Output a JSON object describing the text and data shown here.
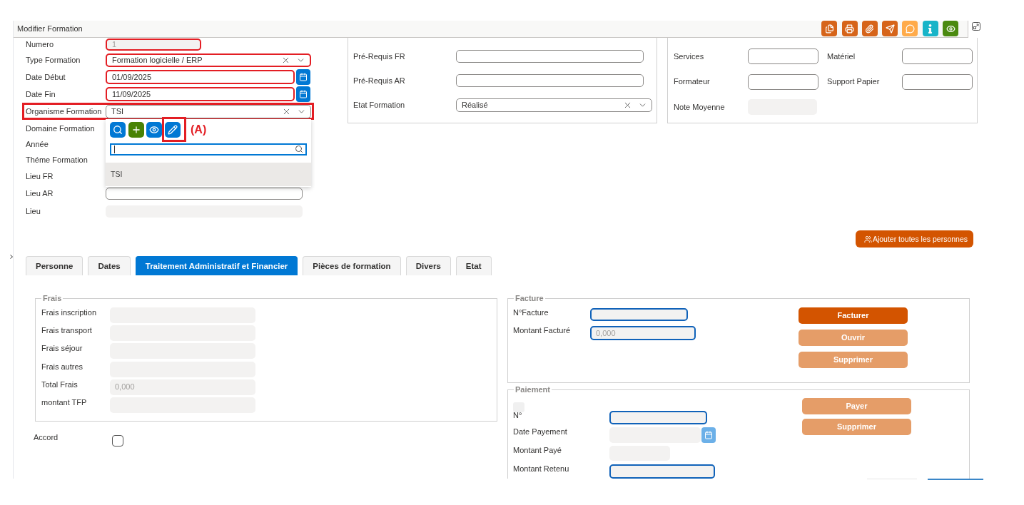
{
  "header": {
    "title": "Modifier Formation",
    "actions": [
      {
        "kind": "documents",
        "color": "#d6641a"
      },
      {
        "kind": "print",
        "color": "#d6641a"
      },
      {
        "kind": "attach",
        "color": "#d6641a"
      },
      {
        "kind": "send",
        "color": "#d6641a"
      },
      {
        "kind": "comment",
        "color": "#ffab4a"
      },
      {
        "kind": "info",
        "color": "#18b4c8"
      },
      {
        "kind": "view",
        "color": "#4b8a10"
      }
    ]
  },
  "identity": {
    "rows": [
      {
        "label": "Numero",
        "kind": "number",
        "value": "1",
        "highlighted": true
      },
      {
        "label": "Type Formation",
        "kind": "select",
        "value": "Formation logicielle / ERP",
        "highlighted": true
      },
      {
        "label": "Date Début",
        "kind": "date",
        "value": "01/09/2025",
        "highlighted": true
      },
      {
        "label": "Date Fin",
        "kind": "date",
        "value": "11/09/2025",
        "highlighted": true
      },
      {
        "label": "Organisme Formation",
        "kind": "select",
        "value": "TSI",
        "framed": true,
        "dropdown": {
          "actions": [
            {
              "kind": "search"
            },
            {
              "kind": "add"
            },
            {
              "kind": "view"
            },
            {
              "kind": "edit",
              "highlighted": true,
              "annotation": "(A)"
            }
          ],
          "options": [
            {
              "label": "TSI",
              "selected": true
            }
          ]
        }
      },
      {
        "label": "Domaine Formation"
      },
      {
        "label": "Année"
      },
      {
        "label": "Théme Formation"
      },
      {
        "label": "Lieu FR"
      },
      {
        "label": "Lieu AR",
        "kind": "text"
      },
      {
        "label": "Lieu",
        "kind": "disabled"
      }
    ]
  },
  "prerequisites": {
    "rows": [
      {
        "label": "Pré-Requis FR",
        "kind": "text"
      },
      {
        "label": "Pré-Requis AR",
        "kind": "text"
      },
      {
        "label": "Etat Formation",
        "kind": "select",
        "value": "Réalisé"
      }
    ]
  },
  "note": {
    "rows": [
      {
        "label": "Services",
        "kind": "text"
      },
      {
        "label": "Matériel",
        "kind": "text"
      },
      {
        "label": "Formateur",
        "kind": "text"
      },
      {
        "label": "Support Papier",
        "kind": "text"
      },
      {
        "label": "Note Moyenne",
        "kind": "disabled"
      }
    ]
  },
  "add_all_button": {
    "label": "Ajouter toutes les personnes"
  },
  "tabs": [
    {
      "label": "Personne",
      "selected": false
    },
    {
      "label": "Dates",
      "selected": false
    },
    {
      "label": "Traitement Administratif et Financier",
      "selected": true
    },
    {
      "label": "Pièces de formation",
      "selected": false
    },
    {
      "label": "Divers",
      "selected": false
    },
    {
      "label": "Etat",
      "selected": false
    }
  ],
  "frais": {
    "legend": "Frais",
    "rows": [
      {
        "label": "Frais inscription"
      },
      {
        "label": "Frais transport"
      },
      {
        "label": "Frais séjour"
      },
      {
        "label": "Frais autres"
      },
      {
        "label": "Total Frais",
        "placeholder": "0,000"
      },
      {
        "label": "montant TFP"
      }
    ]
  },
  "accord": {
    "label": "Accord",
    "checked": false
  },
  "facture": {
    "legend": "Facture",
    "fields": [
      {
        "label": "N°Facture"
      },
      {
        "label": "Montant Facturé",
        "placeholder": "0,000"
      }
    ],
    "buttons": [
      {
        "label": "Facturer",
        "disabled": false
      },
      {
        "label": "Ouvrir",
        "disabled": true
      },
      {
        "label": "Supprimer",
        "disabled": true
      }
    ]
  },
  "paiement": {
    "legend": "Paiement",
    "fields": [
      {
        "label": "N°",
        "kind": "required"
      },
      {
        "label": "Date Payement",
        "kind": "date_disabled"
      },
      {
        "label": "Montant Payé",
        "kind": "disabled"
      },
      {
        "label": "Montant Retenu",
        "kind": "required"
      }
    ],
    "buttons": [
      {
        "label": "Payer",
        "disabled": true
      },
      {
        "label": "Supprimer",
        "disabled": true
      }
    ]
  }
}
